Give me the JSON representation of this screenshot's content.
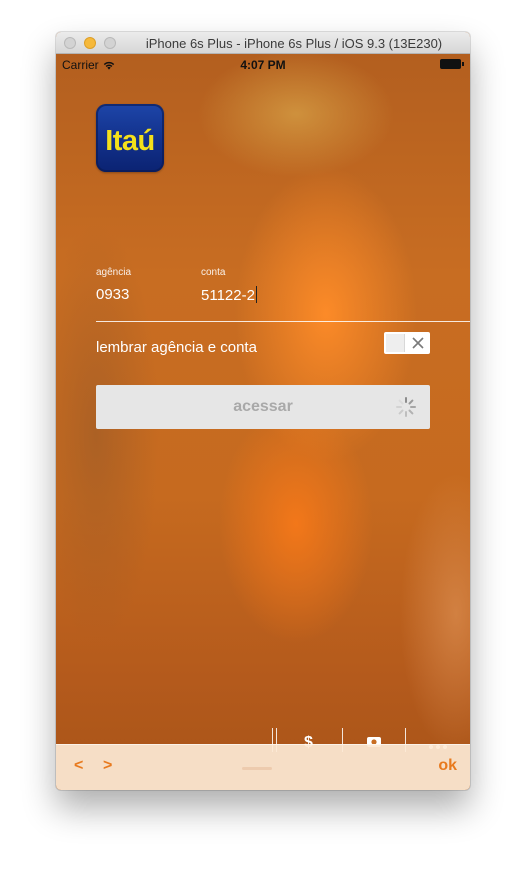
{
  "window": {
    "title": "iPhone 6s Plus - iPhone 6s Plus / iOS 9.3 (13E230)"
  },
  "status_bar": {
    "carrier": "Carrier",
    "time": "4:07 PM"
  },
  "logo": {
    "text": "Itaú"
  },
  "form": {
    "agency": {
      "label": "agência",
      "value": "0933"
    },
    "account": {
      "label": "conta",
      "value": "51122-2"
    },
    "remember_label": "lembrar agência e conta",
    "remember_enabled": false,
    "access_button_label": "acessar"
  },
  "tab_strip": {
    "glyphs": [
      "$"
    ]
  },
  "accessory_bar": {
    "prev_label": "<",
    "next_label": ">",
    "ok_label": "ok"
  },
  "colors": {
    "accent": "#e87a1e",
    "logo_blue": "#12308a",
    "logo_yellow": "#f4e01b",
    "background_orange": "#c66a1f"
  },
  "icons": [
    "wifi-icon",
    "battery-icon",
    "close-x-icon",
    "spinner-icon"
  ]
}
